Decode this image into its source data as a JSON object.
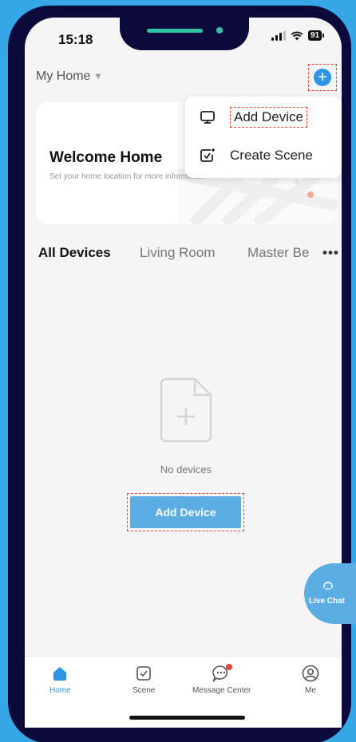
{
  "status_bar": {
    "time": "15:18",
    "battery": "91"
  },
  "header": {
    "home_name": "My Home"
  },
  "welcome": {
    "title": "Welcome Home",
    "subtitle": "Set your home location for more information"
  },
  "menu": {
    "items": [
      {
        "label": "Add Device",
        "icon": "add-device-icon"
      },
      {
        "label": "Create Scene",
        "icon": "create-scene-icon"
      }
    ]
  },
  "tabs": [
    "All Devices",
    "Living Room",
    "Master Be",
    "•••"
  ],
  "empty_state": {
    "message": "No devices",
    "button": "Add Device"
  },
  "live_chat": {
    "label": "Live Chat"
  },
  "tabbar": {
    "items": [
      {
        "label": "Home",
        "icon": "home-icon"
      },
      {
        "label": "Scene",
        "icon": "scene-icon"
      },
      {
        "label": "Message Center",
        "icon": "message-icon"
      },
      {
        "label": "Me",
        "icon": "profile-icon"
      }
    ]
  },
  "colors": {
    "accent": "#2e94e4",
    "button": "#5aaee3",
    "background": "#36a6e6",
    "frame": "#0c0a3a",
    "highlight": "#e0443a"
  }
}
